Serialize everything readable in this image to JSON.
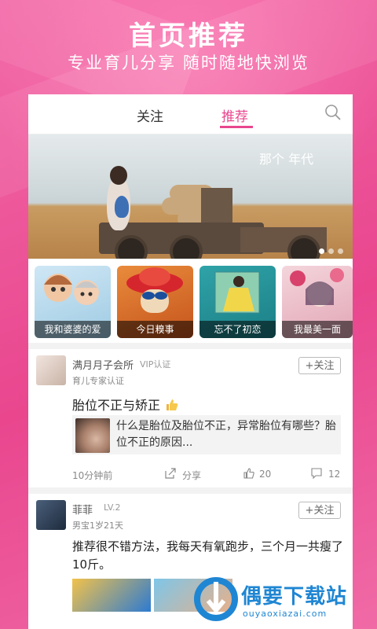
{
  "header": {
    "title": "首页推荐",
    "subtitle": "专业育儿分享  随时随地快浏览"
  },
  "tabs": [
    {
      "label": "关注",
      "active": false
    },
    {
      "label": "推荐",
      "active": true
    }
  ],
  "banner": {
    "text": "那个 年代",
    "dots_count": 3,
    "active_dot": 0
  },
  "categories": [
    {
      "label": "我和婆婆的爱"
    },
    {
      "label": "今日糗事"
    },
    {
      "label": "忘不了初恋"
    },
    {
      "label": "我最美一面"
    }
  ],
  "posts": [
    {
      "user": "满月月子会所",
      "badge": "VIP认证",
      "subtitle": "育儿专家认证",
      "follow": "+关注",
      "title": "胎位不正与矫正",
      "quote": "什么是胎位及胎位不正，异常胎位有哪些？胎位不正的原因...",
      "time": "10分钟前",
      "share": "分享",
      "likes": "20",
      "comments": "12"
    },
    {
      "user": "菲菲",
      "badge": "LV.2",
      "subtitle": "男宝1岁21天",
      "follow": "+关注",
      "text": "推荐很不错方法，我每天有氧跑步，三个月一共瘦了10斤。"
    }
  ],
  "watermark": {
    "title": "偶要下载站",
    "sub": "ouyaoxiazai.com"
  },
  "colors": {
    "accent": "#e9468e",
    "background": "#ef5a9c",
    "watermark": "#1f86d3"
  }
}
